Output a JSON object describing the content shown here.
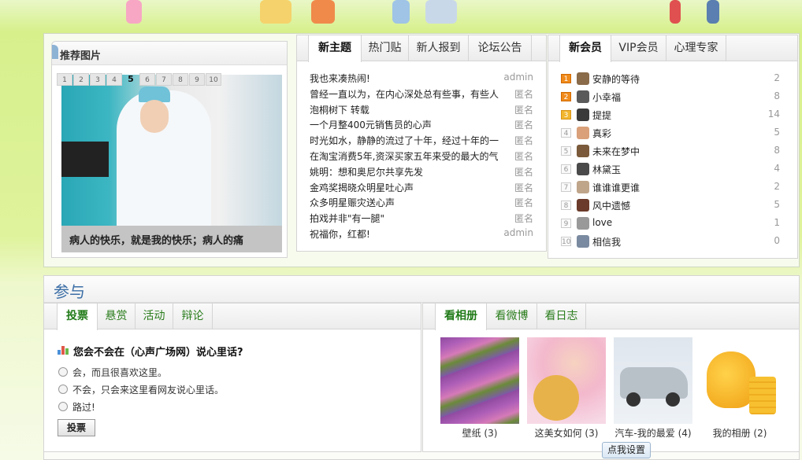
{
  "recommend": {
    "title": "推荐图片",
    "pages": [
      "1",
      "2",
      "3",
      "4",
      "5",
      "6",
      "7",
      "8",
      "9",
      "10"
    ],
    "current_page": "5",
    "caption": "病人的快乐，就是我的快乐；病人的痛"
  },
  "topics": {
    "tabs": [
      "新主题",
      "热门贴",
      "新人报到",
      "论坛公告"
    ],
    "rows": [
      {
        "title": "我也来凑热闹!",
        "author": "admin"
      },
      {
        "title": "曾经一直以为，在内心深处总有些事，有些人",
        "author": "匿名"
      },
      {
        "title": "泡桐树下 转载",
        "author": "匿名"
      },
      {
        "title": "一个月整400元销售员的心声",
        "author": "匿名"
      },
      {
        "title": "时光如水，静静的流过了十年，经过十年的一",
        "author": "匿名"
      },
      {
        "title": "在淘宝消费5年,资深买家五年来受的最大的气",
        "author": "匿名"
      },
      {
        "title": "姚明：想和奥尼尔共享先发",
        "author": "匿名"
      },
      {
        "title": "金鸡奖揭晓众明星吐心声",
        "author": "匿名"
      },
      {
        "title": "众多明星赈灾送心声",
        "author": "匿名"
      },
      {
        "title": "拍戏并非\"有一腿\"",
        "author": "匿名"
      },
      {
        "title": "祝福你，红都!",
        "author": "admin"
      }
    ]
  },
  "members": {
    "tabs": [
      "新会员",
      "VIP会员",
      "心理专家"
    ],
    "rows": [
      {
        "rank": "1",
        "name": "安静的等待",
        "count": "2"
      },
      {
        "rank": "2",
        "name": "小幸福",
        "count": "8"
      },
      {
        "rank": "3",
        "name": "提提",
        "count": "14"
      },
      {
        "rank": "4",
        "name": "真彩",
        "count": "5"
      },
      {
        "rank": "5",
        "name": "未来在梦中",
        "count": "8"
      },
      {
        "rank": "6",
        "name": "林黛玉",
        "count": "4"
      },
      {
        "rank": "7",
        "name": "谁谁谁更谁",
        "count": "2"
      },
      {
        "rank": "8",
        "name": "风中遗憾",
        "count": "5"
      },
      {
        "rank": "9",
        "name": "love",
        "count": "1"
      },
      {
        "rank": "10",
        "name": "相信我",
        "count": "0"
      }
    ]
  },
  "section_title": "参与",
  "vote": {
    "tabs": [
      "投票",
      "悬赏",
      "活动",
      "辩论"
    ],
    "question": "您会不会在（心声广场网）说心里话?",
    "options": [
      "会，而且很喜欢这里。",
      "不会，只会来这里看网友说心里话。",
      "路过!"
    ],
    "button": "投票"
  },
  "albums": {
    "tabs": [
      "看相册",
      "看微博",
      "看日志"
    ],
    "items": [
      {
        "label": "壁纸 (3)"
      },
      {
        "label": "这美女如何 (3)"
      },
      {
        "label": "汽车-我的最爱 (4)"
      },
      {
        "label": "我的相册 (2)"
      }
    ],
    "settings_button": "点我设置"
  }
}
